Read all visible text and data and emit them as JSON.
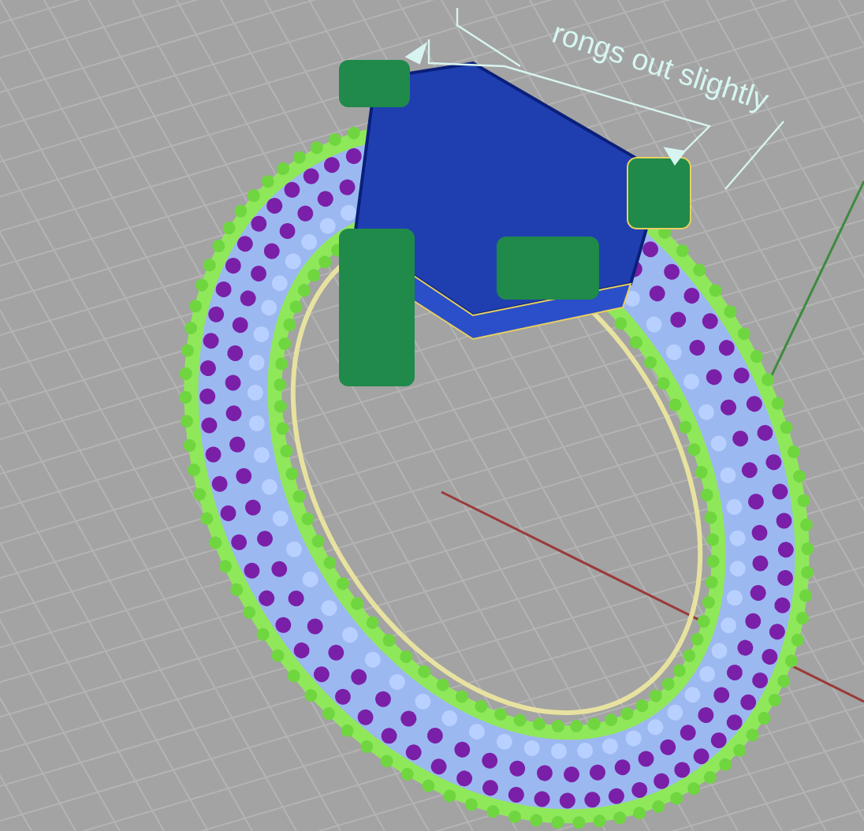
{
  "viewport": {
    "annotation": "rongs out slightly"
  }
}
